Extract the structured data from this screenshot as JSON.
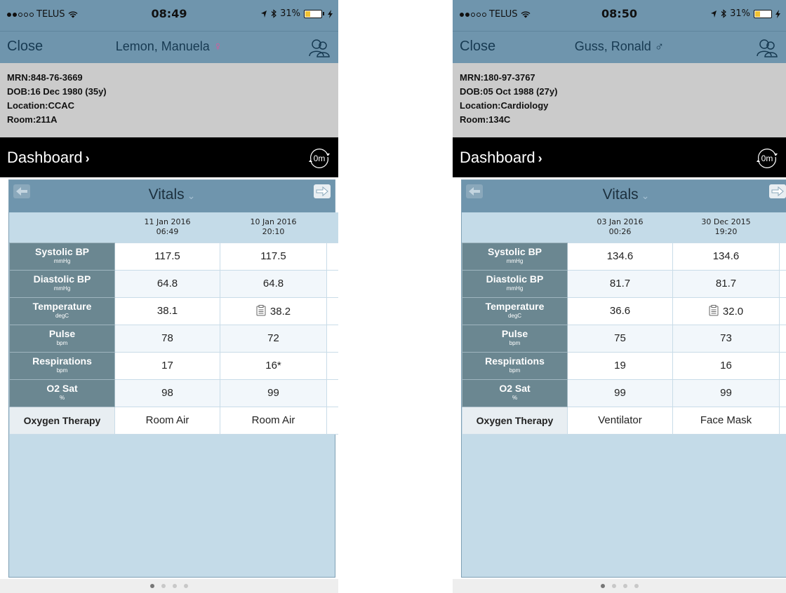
{
  "screens": [
    {
      "status": {
        "carrier": "TELUS",
        "time": "08:49",
        "battery": "31%",
        "battery_level": 0.31
      },
      "nav": {
        "close_label": "Close",
        "patient_name": "Lemon, Manuela",
        "gender_symbol": "♀"
      },
      "patient": {
        "mrn": "MRN:848-76-3669",
        "dob": "DOB:16 Dec 1980 (35y)",
        "location": "Location:CCAC",
        "room": "Room:211A"
      },
      "dashboard": {
        "title": "Dashboard",
        "refresh_label": "0m"
      },
      "panel": {
        "title": "Vitals",
        "dates": [
          {
            "date": "11 Jan 2016",
            "time": "06:49"
          },
          {
            "date": "10 Jan 2016",
            "time": "20:10"
          }
        ],
        "rows": [
          {
            "label": "Systolic BP",
            "unit": "mmHg",
            "values": [
              "117.5",
              "117.5"
            ]
          },
          {
            "label": "Diastolic BP",
            "unit": "mmHg",
            "values": [
              "64.8",
              "64.8"
            ]
          },
          {
            "label": "Temperature",
            "unit": "degC",
            "values": [
              "38.1",
              "38.2"
            ]
          },
          {
            "label": "Pulse",
            "unit": "bpm",
            "values": [
              "78",
              "72"
            ]
          },
          {
            "label": "Respirations",
            "unit": "bpm",
            "values": [
              "17",
              "16*"
            ]
          },
          {
            "label": "O2 Sat",
            "unit": "%",
            "values": [
              "98",
              "99"
            ]
          }
        ],
        "oxygen": {
          "label": "Oxygen Therapy",
          "values": [
            "Room Air",
            "Room Air"
          ]
        }
      }
    },
    {
      "status": {
        "carrier": "TELUS",
        "time": "08:50",
        "battery": "31%",
        "battery_level": 0.31
      },
      "nav": {
        "close_label": "Close",
        "patient_name": "Guss, Ronald",
        "gender_symbol": "♂"
      },
      "patient": {
        "mrn": "MRN:180-97-3767",
        "dob": "DOB:05 Oct 1988 (27y)",
        "location": "Location:Cardiology",
        "room": "Room:134C"
      },
      "dashboard": {
        "title": "Dashboard",
        "refresh_label": "0m"
      },
      "panel": {
        "title": "Vitals",
        "dates": [
          {
            "date": "03 Jan 2016",
            "time": "00:26"
          },
          {
            "date": "30 Dec 2015",
            "time": "19:20"
          }
        ],
        "rows": [
          {
            "label": "Systolic BP",
            "unit": "mmHg",
            "values": [
              "134.6",
              "134.6"
            ]
          },
          {
            "label": "Diastolic BP",
            "unit": "mmHg",
            "values": [
              "81.7",
              "81.7"
            ]
          },
          {
            "label": "Temperature",
            "unit": "degC",
            "values": [
              "36.6",
              "32.0"
            ]
          },
          {
            "label": "Pulse",
            "unit": "bpm",
            "values": [
              "75",
              "73"
            ]
          },
          {
            "label": "Respirations",
            "unit": "bpm",
            "values": [
              "19",
              "16"
            ]
          },
          {
            "label": "O2 Sat",
            "unit": "%",
            "values": [
              "99",
              "99"
            ]
          }
        ],
        "oxygen": {
          "label": "Oxygen Therapy",
          "values": [
            "Ventilator",
            "Face Mask"
          ]
        }
      }
    }
  ],
  "icons": {
    "wifi": "wifi-icon",
    "location": "location-arrow-icon",
    "bluetooth": "bluetooth-icon",
    "battery": "battery-icon",
    "charging": "charging-bolt-icon",
    "user": "patient-profile-icon",
    "refresh": "refresh-icon",
    "prev": "arrow-left-icon",
    "next": "arrow-right-icon",
    "note": "clipboard-note-icon",
    "dropdown": "chevron-down-icon"
  },
  "colors": {
    "nav": "#6f95ad",
    "info": "#cbcbcb",
    "dash": "#000000",
    "panel": "#c4dbe8",
    "label_cell": "#6b8791",
    "female": "#e0559c",
    "battery": "#f1c232"
  },
  "page_indicator": {
    "count": 4,
    "active": 0
  }
}
